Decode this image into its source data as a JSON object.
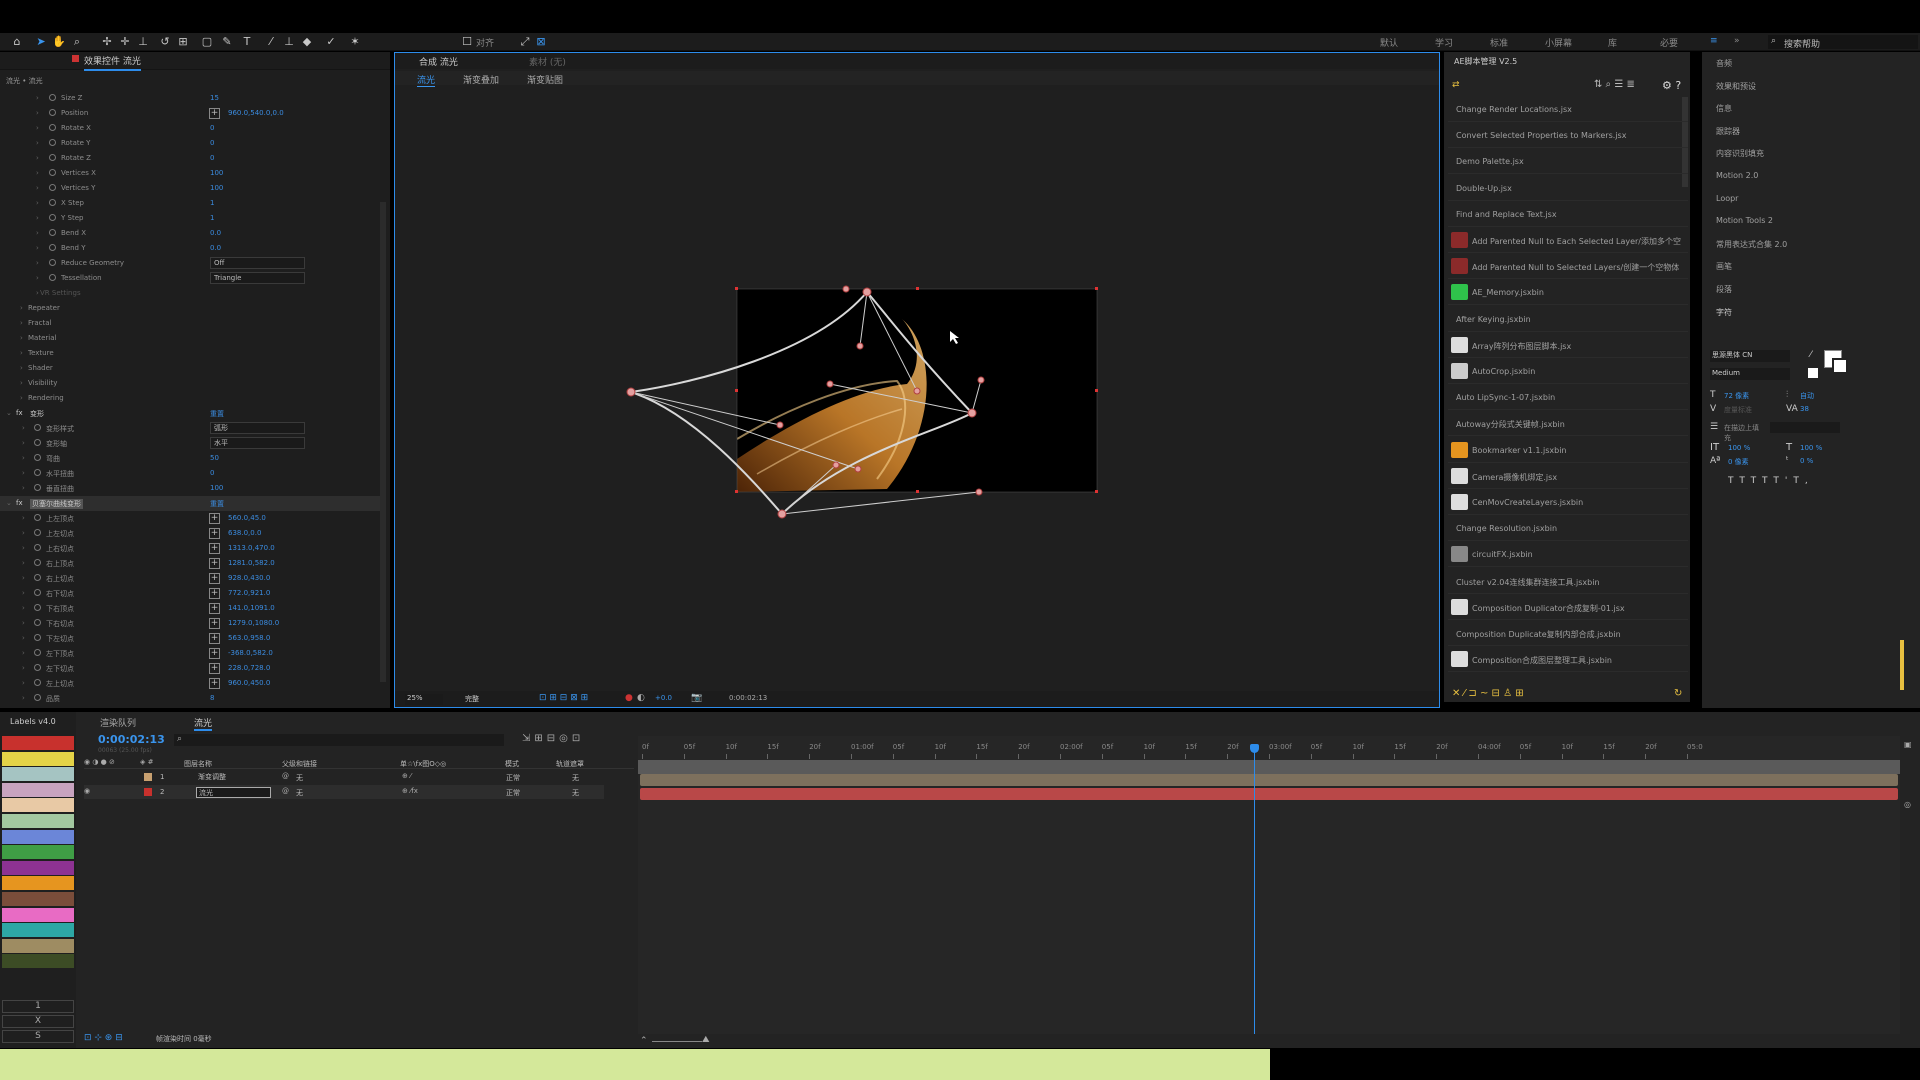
{
  "toolbar": {
    "toggle_label": "对齐"
  },
  "workspaces": [
    "默认",
    "学习",
    "标准",
    "小屏幕",
    "库",
    "必要"
  ],
  "search": {
    "placeholder": "搜索帮助"
  },
  "effect_panel": {
    "tab": "效果控件 流光",
    "layer_path": "流光 • 流光",
    "props": [
      {
        "name": "Size Z",
        "value": "15"
      },
      {
        "name": "Position",
        "value": "960.0,540.0,0.0",
        "pos": true
      },
      {
        "name": "Rotate X",
        "value": "0"
      },
      {
        "name": "Rotate Y",
        "value": "0"
      },
      {
        "name": "Rotate Z",
        "value": "0"
      },
      {
        "name": "Vertices X",
        "value": "100"
      },
      {
        "name": "Vertices Y",
        "value": "100"
      },
      {
        "name": "X Step",
        "value": "1"
      },
      {
        "name": "Y Step",
        "value": "1"
      },
      {
        "name": "Bend X",
        "value": "0.0"
      },
      {
        "name": "Bend Y",
        "value": "0.0"
      },
      {
        "name": "Reduce Geometry",
        "value": "Off",
        "dropdown": true
      },
      {
        "name": "Tessellation",
        "value": "Triangle",
        "dropdown": true
      }
    ],
    "groups": [
      "VR Settings",
      "Repeater",
      "Fractal",
      "Material",
      "Texture",
      "Shader",
      "Visibility",
      "Rendering"
    ],
    "fx1": {
      "name": "变形",
      "reset": "重置",
      "props": [
        {
          "name": "变形样式",
          "value": "弧形",
          "dropdown": true
        },
        {
          "name": "变形轴",
          "value": "水平",
          "dropdown": true
        },
        {
          "name": "弯曲",
          "value": "50"
        },
        {
          "name": "水平扭曲",
          "value": "0"
        },
        {
          "name": "垂直扭曲",
          "value": "100"
        }
      ]
    },
    "fx2": {
      "name": "贝塞尔曲线变形",
      "reset": "重置",
      "props": [
        {
          "name": "上左顶点",
          "value": "560.0,45.0"
        },
        {
          "name": "上左切点",
          "value": "638.0,0.0"
        },
        {
          "name": "上右切点",
          "value": "1313.0,470.0"
        },
        {
          "name": "右上顶点",
          "value": "1281.0,582.0"
        },
        {
          "name": "右上切点",
          "value": "928.0,430.0"
        },
        {
          "name": "右下切点",
          "value": "772.0,921.0"
        },
        {
          "name": "下右顶点",
          "value": "141.0,1091.0"
        },
        {
          "name": "下右切点",
          "value": "1279.0,1080.0"
        },
        {
          "name": "下左切点",
          "value": "563.0,958.0"
        },
        {
          "name": "左下顶点",
          "value": "-368.0,582.0"
        },
        {
          "name": "左下切点",
          "value": "228.0,728.0"
        },
        {
          "name": "左上切点",
          "value": "960.0,450.0"
        },
        {
          "name": "品质",
          "value": "8"
        }
      ]
    }
  },
  "comp_panel": {
    "tab": "合成 流光",
    "locked_tab": "素材 (无)",
    "crumbs": [
      "流光",
      "渐变叠加",
      "渐变贴图"
    ],
    "zoom": "25%",
    "quality": "完整",
    "exposure": "+0.0",
    "timecode": "0:00:02:13"
  },
  "scripts_panel": {
    "title": "AE脚本管理 V2.5",
    "items": [
      "Change Render Locations.jsx",
      "Convert Selected Properties to Markers.jsx",
      "Demo Palette.jsx",
      "Double-Up.jsx",
      "Find and Replace Text.jsx",
      "Add Parented Null to Each Selected Layer/添加多个空",
      "Add Parented Null to Selected Layers/创建一个空物体",
      "AE_Memory.jsxbin",
      "After Keying.jsxbin",
      "Array阵列分布图层脚本.jsx",
      "AutoCrop.jsxbin",
      "Auto LipSync-1-07.jsxbin",
      "Autoway分段式关键帧.jsxbin",
      "Bookmarker v1.1.jsxbin",
      "Camera摄像机绑定.jsx",
      "CenMovCreateLayers.jsxbin",
      "Change Resolution.jsxbin",
      "circuitFX.jsxbin",
      "Cluster v2.04连线集群连接工具.jsxbin",
      "Composition Duplicator合成复制-01.jsx",
      "Composition Duplicate复制内部合成.jsxbin",
      "Composition合成图层整理工具.jsxbin"
    ]
  },
  "right_panel": {
    "items": [
      "音频",
      "效果和预设",
      "信息",
      "跟踪器",
      "内容识别填充",
      "Motion 2.0",
      "Loopr",
      "Motion Tools 2",
      "常用表达式合集 2.0",
      "画笔",
      "段落",
      "字符"
    ],
    "character": {
      "font": "思源黑体 CN",
      "style": "Medium",
      "size": "72 像素",
      "leading": "自动",
      "kerning": "度量标准",
      "tracking": "38",
      "vscale": "100 %",
      "hscale": "100 %",
      "baseline": "0 像素",
      "tsume": "0 %",
      "stroke": "在描边上填充"
    }
  },
  "timeline": {
    "labels_tab": "Labels v4.0",
    "render_tab": "渲染队列",
    "comp_tab": "流光",
    "timecode": "0:00:02:13",
    "fps": "00063 (25.00 fps)",
    "headers": {
      "name": "图层名称",
      "parent": "父级和链接",
      "mode": "模式",
      "switches": "单☆\\fx图O◇◎",
      "trkmat": "轨道遮罩"
    },
    "layers": [
      {
        "num": "1",
        "name": "渐变调整",
        "parent": "无",
        "mode": "正常",
        "trk": "无"
      },
      {
        "num": "2",
        "name": "流光",
        "parent": "无",
        "mode": "正常",
        "trk": "无"
      }
    ],
    "ticks": [
      "0f",
      "05f",
      "10f",
      "15f",
      "20f",
      "01:00f",
      "05f",
      "10f",
      "15f",
      "20f",
      "02:00f",
      "05f",
      "10f",
      "15f",
      "20f",
      "03:00f",
      "05f",
      "10f",
      "15f",
      "20f",
      "04:00f",
      "05f",
      "10f",
      "15f",
      "20f",
      "05:0"
    ],
    "footer": "帧渲染时间 0毫秒",
    "playhead_fraction": 0.488
  },
  "label_colors": [
    "#c8312d",
    "#e4d347",
    "#a5c4c2",
    "#c8a3bf",
    "#e8c9a5",
    "#a3c8a0",
    "#6b86d8",
    "#3f9e45",
    "#8d3292",
    "#e6951f",
    "#7a4d3a",
    "#e86bc4",
    "#2da7a5",
    "#9e8c62",
    "#3c4c25"
  ],
  "label_letters": [
    "1",
    "X",
    "S"
  ],
  "colors": {
    "accent": "#2d8ceb",
    "selected_layer": "#b94848",
    "layer_bar": "#7d705d"
  }
}
